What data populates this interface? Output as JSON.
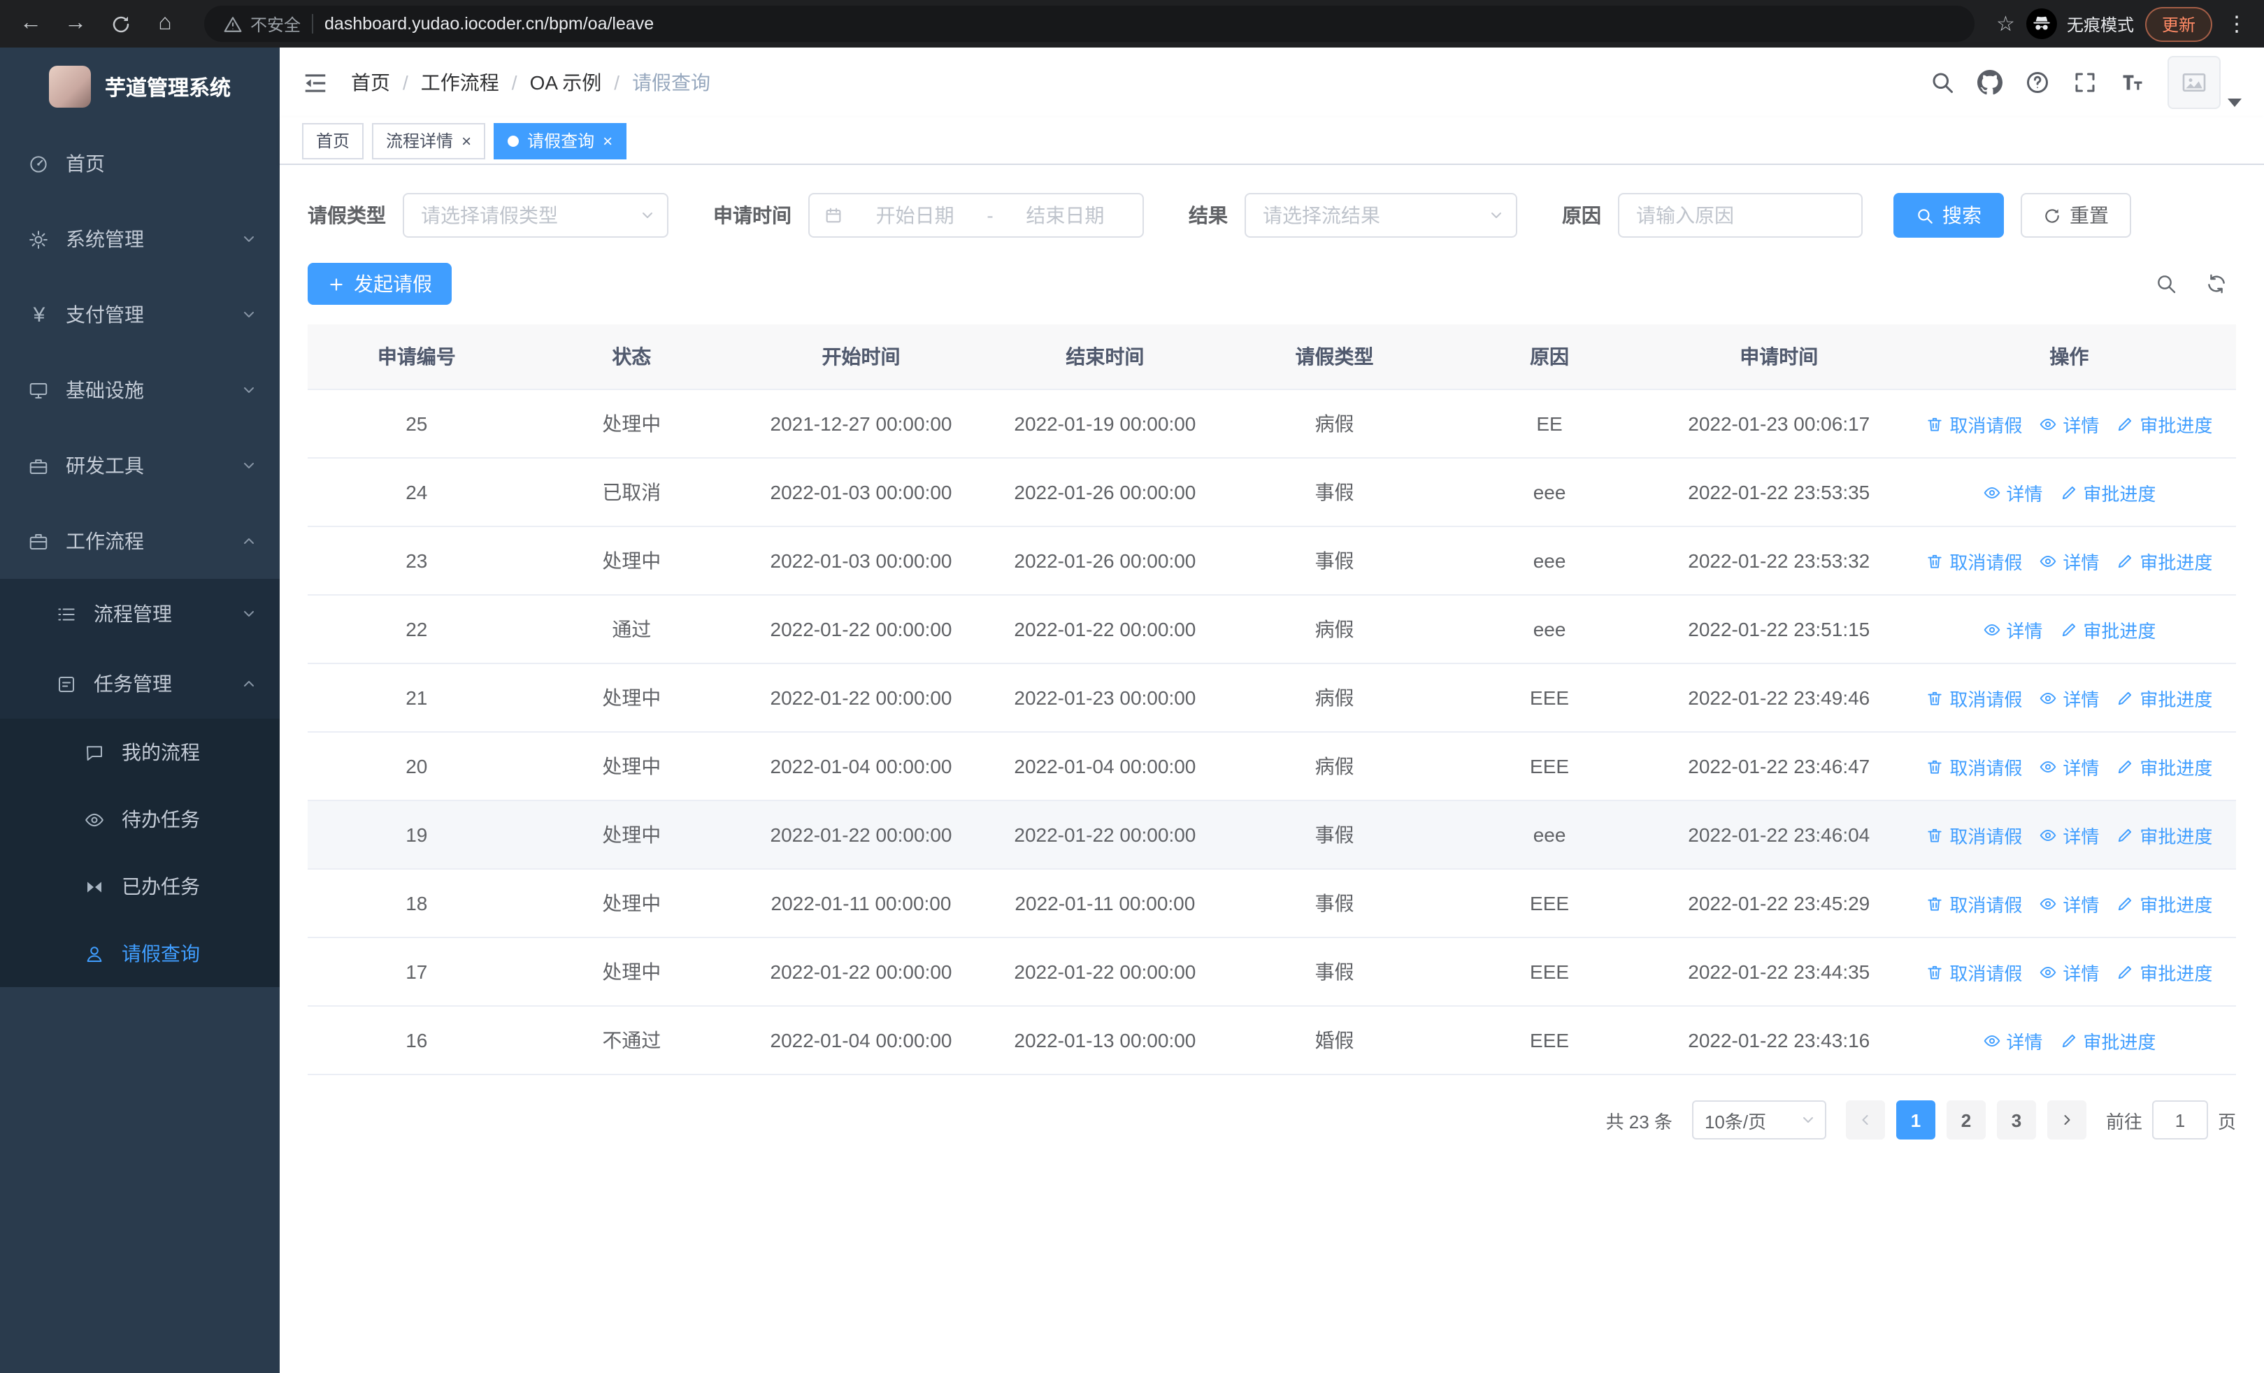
{
  "browser": {
    "security_label": "不安全",
    "url": "dashboard.yudao.iocoder.cn/bpm/oa/leave",
    "incognito_label": "无痕模式",
    "update_label": "更新"
  },
  "sidebar": {
    "logo_title": "芋道管理系统",
    "items": [
      {
        "label": "首页"
      },
      {
        "label": "系统管理"
      },
      {
        "label": "支付管理"
      },
      {
        "label": "基础设施"
      },
      {
        "label": "研发工具"
      },
      {
        "label": "工作流程"
      }
    ],
    "workflow_children": [
      {
        "label": "流程管理"
      },
      {
        "label": "任务管理"
      }
    ],
    "task_children": [
      {
        "label": "我的流程"
      },
      {
        "label": "待办任务"
      },
      {
        "label": "已办任务"
      },
      {
        "label": "请假查询"
      }
    ]
  },
  "navbar": {
    "separator": "/",
    "breadcrumbs": [
      {
        "label": "首页"
      },
      {
        "label": "工作流程"
      },
      {
        "label": "OA 示例"
      },
      {
        "label": "请假查询"
      }
    ]
  },
  "tabs": [
    {
      "label": "首页"
    },
    {
      "label": "流程详情"
    },
    {
      "label": "请假查询"
    }
  ],
  "filters": {
    "leave_type_label": "请假类型",
    "leave_type_placeholder": "请选择请假类型",
    "apply_time_label": "申请时间",
    "start_date_placeholder": "开始日期",
    "range_separator": "-",
    "end_date_placeholder": "结束日期",
    "result_label": "结果",
    "result_placeholder": "请选择流结果",
    "reason_label": "原因",
    "reason_placeholder": "请输入原因",
    "search_label": "搜索",
    "reset_label": "重置"
  },
  "toolbar": {
    "create_label": "发起请假"
  },
  "table": {
    "columns": [
      "申请编号",
      "状态",
      "开始时间",
      "结束时间",
      "请假类型",
      "原因",
      "申请时间",
      "操作"
    ],
    "rows": [
      {
        "id": "25",
        "status": "处理中",
        "start_time": "2021-12-27 00:00:00",
        "end_time": "2022-01-19 00:00:00",
        "leave_type": "病假",
        "reason": "EE",
        "apply_time": "2022-01-23 00:06:17",
        "highlighted": false,
        "actions": [
          {
            "key": "cancel",
            "label": "取消请假"
          },
          {
            "key": "detail",
            "label": "详情"
          },
          {
            "key": "progress",
            "label": "审批进度"
          }
        ]
      },
      {
        "id": "24",
        "status": "已取消",
        "start_time": "2022-01-03 00:00:00",
        "end_time": "2022-01-26 00:00:00",
        "leave_type": "事假",
        "reason": "eee",
        "apply_time": "2022-01-22 23:53:35",
        "highlighted": false,
        "actions": [
          {
            "key": "detail",
            "label": "详情"
          },
          {
            "key": "progress",
            "label": "审批进度"
          }
        ]
      },
      {
        "id": "23",
        "status": "处理中",
        "start_time": "2022-01-03 00:00:00",
        "end_time": "2022-01-26 00:00:00",
        "leave_type": "事假",
        "reason": "eee",
        "apply_time": "2022-01-22 23:53:32",
        "highlighted": false,
        "actions": [
          {
            "key": "cancel",
            "label": "取消请假"
          },
          {
            "key": "detail",
            "label": "详情"
          },
          {
            "key": "progress",
            "label": "审批进度"
          }
        ]
      },
      {
        "id": "22",
        "status": "通过",
        "start_time": "2022-01-22 00:00:00",
        "end_time": "2022-01-22 00:00:00",
        "leave_type": "病假",
        "reason": "eee",
        "apply_time": "2022-01-22 23:51:15",
        "highlighted": false,
        "actions": [
          {
            "key": "detail",
            "label": "详情"
          },
          {
            "key": "progress",
            "label": "审批进度"
          }
        ]
      },
      {
        "id": "21",
        "status": "处理中",
        "start_time": "2022-01-22 00:00:00",
        "end_time": "2022-01-23 00:00:00",
        "leave_type": "病假",
        "reason": "EEE",
        "apply_time": "2022-01-22 23:49:46",
        "highlighted": false,
        "actions": [
          {
            "key": "cancel",
            "label": "取消请假"
          },
          {
            "key": "detail",
            "label": "详情"
          },
          {
            "key": "progress",
            "label": "审批进度"
          }
        ]
      },
      {
        "id": "20",
        "status": "处理中",
        "start_time": "2022-01-04 00:00:00",
        "end_time": "2022-01-04 00:00:00",
        "leave_type": "病假",
        "reason": "EEE",
        "apply_time": "2022-01-22 23:46:47",
        "highlighted": false,
        "actions": [
          {
            "key": "cancel",
            "label": "取消请假"
          },
          {
            "key": "detail",
            "label": "详情"
          },
          {
            "key": "progress",
            "label": "审批进度"
          }
        ]
      },
      {
        "id": "19",
        "status": "处理中",
        "start_time": "2022-01-22 00:00:00",
        "end_time": "2022-01-22 00:00:00",
        "leave_type": "事假",
        "reason": "eee",
        "apply_time": "2022-01-22 23:46:04",
        "highlighted": true,
        "actions": [
          {
            "key": "cancel",
            "label": "取消请假"
          },
          {
            "key": "detail",
            "label": "详情"
          },
          {
            "key": "progress",
            "label": "审批进度"
          }
        ]
      },
      {
        "id": "18",
        "status": "处理中",
        "start_time": "2022-01-11 00:00:00",
        "end_time": "2022-01-11 00:00:00",
        "leave_type": "事假",
        "reason": "EEE",
        "apply_time": "2022-01-22 23:45:29",
        "highlighted": false,
        "actions": [
          {
            "key": "cancel",
            "label": "取消请假"
          },
          {
            "key": "detail",
            "label": "详情"
          },
          {
            "key": "progress",
            "label": "审批进度"
          }
        ]
      },
      {
        "id": "17",
        "status": "处理中",
        "start_time": "2022-01-22 00:00:00",
        "end_time": "2022-01-22 00:00:00",
        "leave_type": "事假",
        "reason": "EEE",
        "apply_time": "2022-01-22 23:44:35",
        "highlighted": false,
        "actions": [
          {
            "key": "cancel",
            "label": "取消请假"
          },
          {
            "key": "detail",
            "label": "详情"
          },
          {
            "key": "progress",
            "label": "审批进度"
          }
        ]
      },
      {
        "id": "16",
        "status": "不通过",
        "start_time": "2022-01-04 00:00:00",
        "end_time": "2022-01-13 00:00:00",
        "leave_type": "婚假",
        "reason": "EEE",
        "apply_time": "2022-01-22 23:43:16",
        "highlighted": false,
        "actions": [
          {
            "key": "detail",
            "label": "详情"
          },
          {
            "key": "progress",
            "label": "审批进度"
          }
        ]
      }
    ]
  },
  "pagination": {
    "total_label": "共 23 条",
    "page_size_label": "10条/页",
    "pages": [
      {
        "label": "1",
        "active": true
      },
      {
        "label": "2",
        "active": false
      },
      {
        "label": "3",
        "active": false
      }
    ],
    "goto_label": "前往",
    "goto_value": "1",
    "unit_label": "页"
  }
}
